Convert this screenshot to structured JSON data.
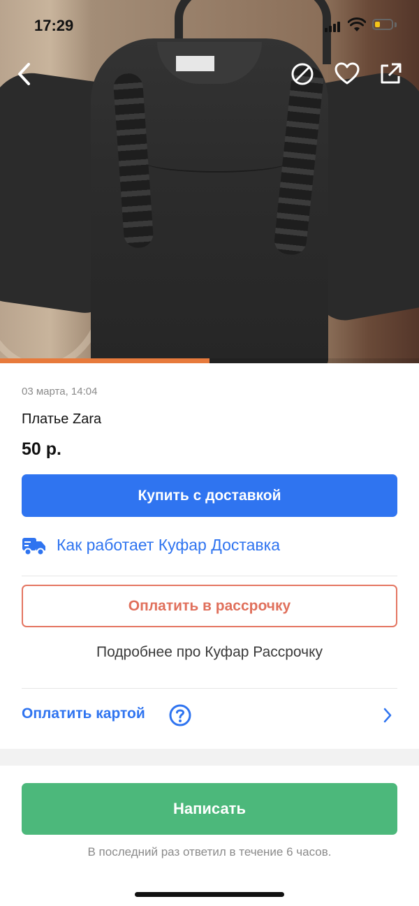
{
  "status_bar": {
    "time": "17:29",
    "battery_level_fraction": 0.25,
    "battery_color": "#f5c518"
  },
  "header": {
    "back_icon": "chevron-left-icon",
    "block_icon": "block-icon",
    "favorite_icon": "heart-outline-icon",
    "share_icon": "share-external-icon"
  },
  "gallery": {
    "progress_fraction": 0.5,
    "progress_color": "#e77a3c"
  },
  "listing": {
    "date": "03 марта, 14:04",
    "title": "Платье Zara",
    "price": "50 р."
  },
  "actions": {
    "buy_with_delivery": "Купить с доставкой",
    "delivery_info_icon": "delivery-truck-icon",
    "delivery_info_link": "Как работает Куфар Доставка",
    "installment_button": "Оплатить в рассрочку",
    "installment_info_link": "Подробнее про Куфар Рассрочку",
    "pay_by_card": "Оплатить картой",
    "pay_by_card_help_icon": "question-circle-icon",
    "pay_by_card_chevron_icon": "chevron-right-icon"
  },
  "footer": {
    "write_button": "Написать",
    "reply_note": "В последний раз ответил в течение 6 часов."
  },
  "colors": {
    "primary_blue": "#2f74f0",
    "installment_red": "#e0705c",
    "write_green": "#4cb87b"
  }
}
